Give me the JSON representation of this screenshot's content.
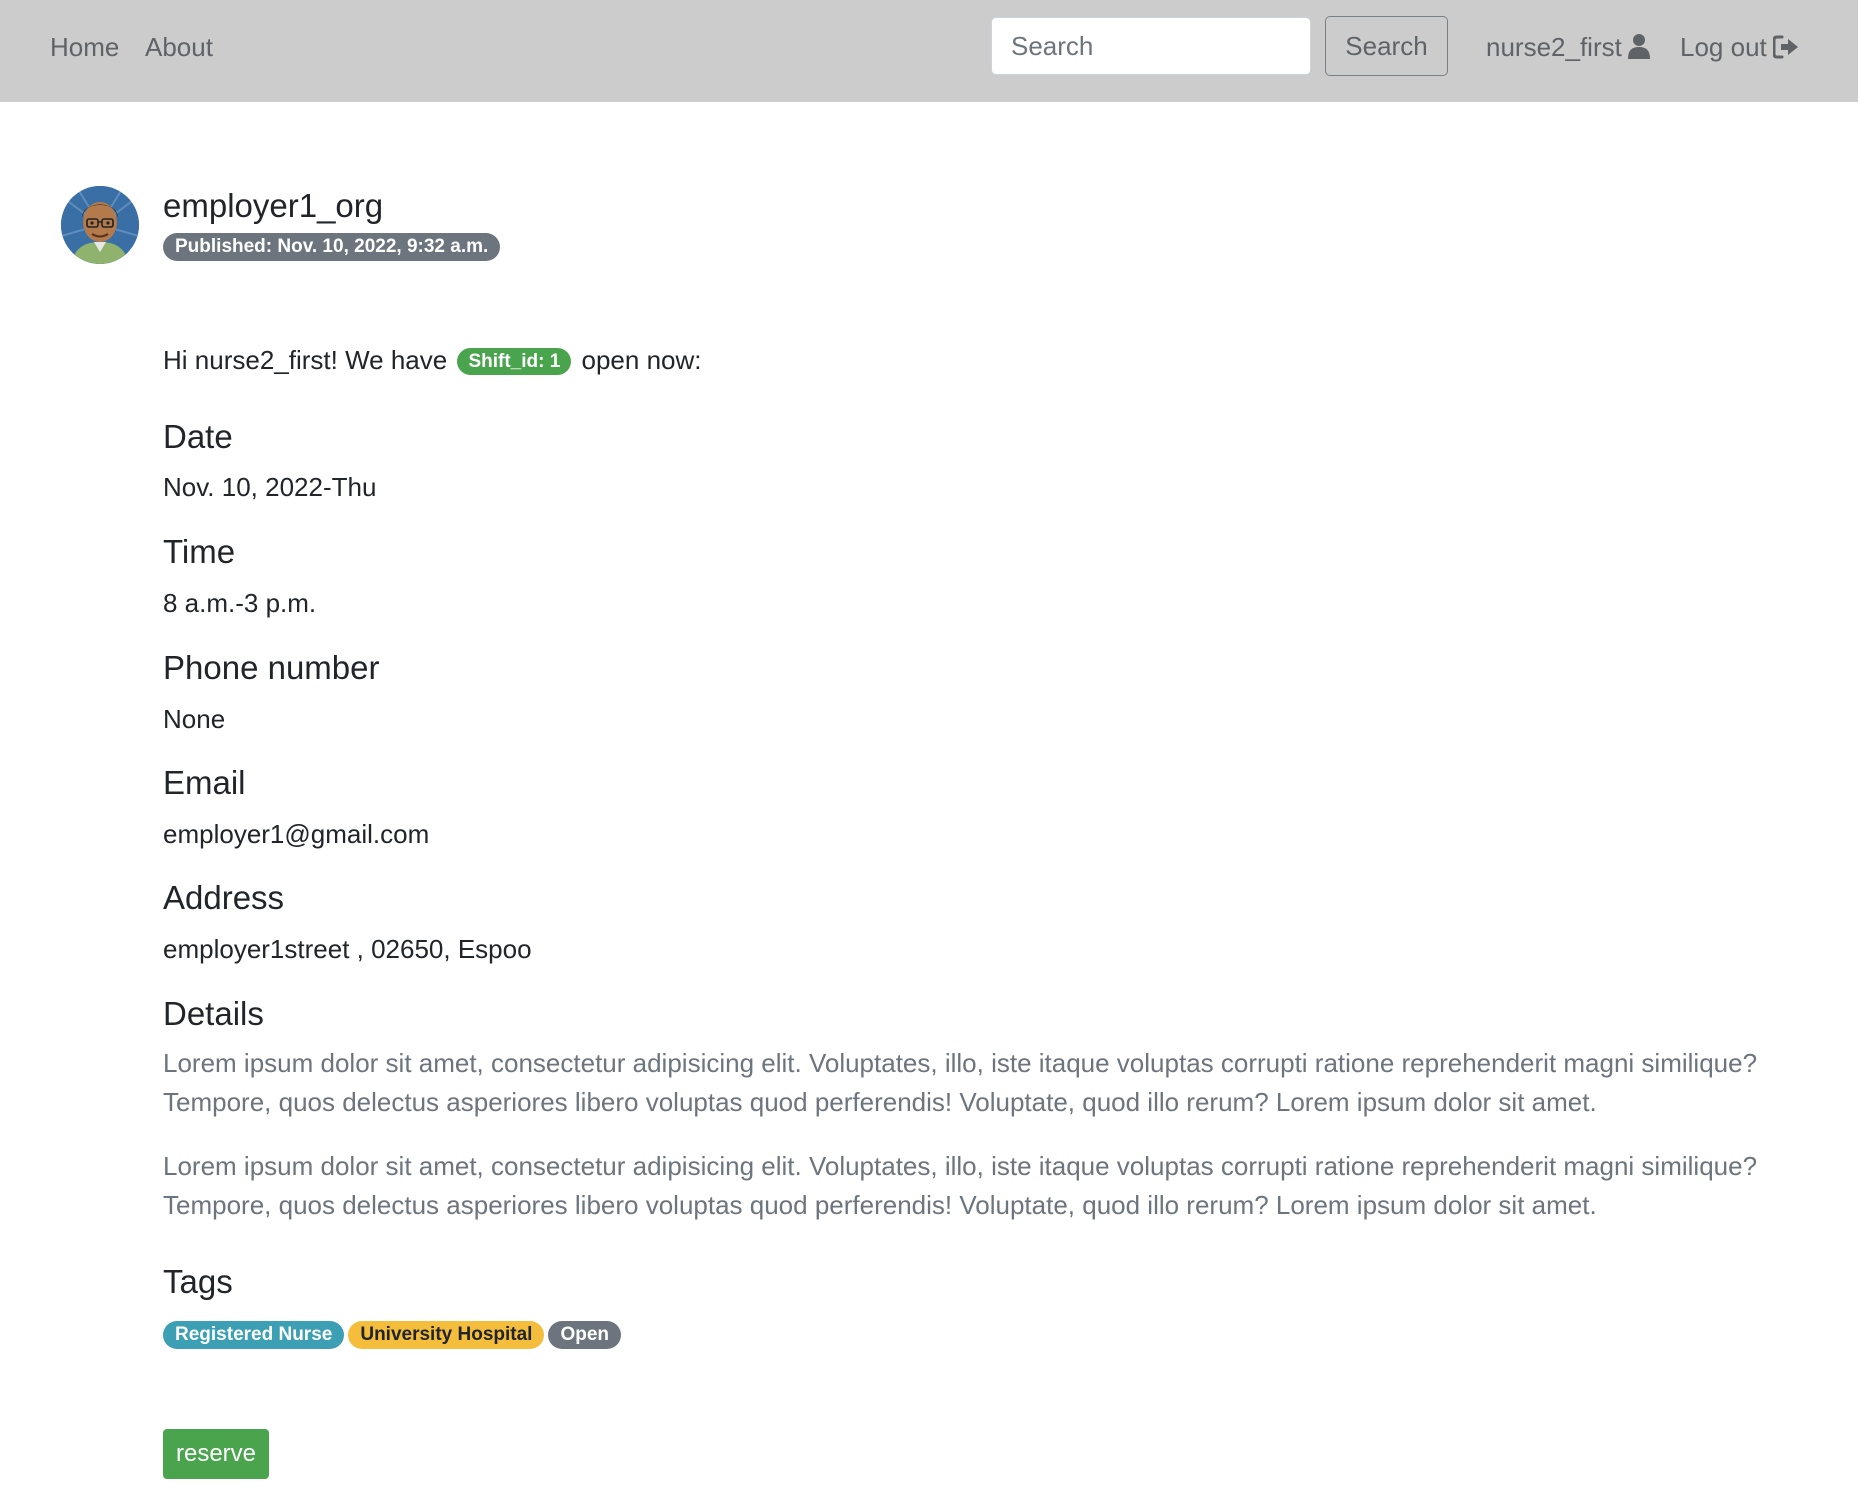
{
  "navbar": {
    "home": "Home",
    "about": "About",
    "search_placeholder": "Search",
    "search_button": "Search",
    "username": "nurse2_first",
    "logout": "Log out"
  },
  "post": {
    "author": "employer1_org",
    "published": "Published: Nov. 10, 2022, 9:32 a.m.",
    "intro_before": "Hi nurse2_first! We have",
    "shift_badge": "Shift_id: 1",
    "intro_after": "open now:",
    "sections": {
      "date": {
        "title": "Date",
        "value": "Nov. 10, 2022-Thu"
      },
      "time": {
        "title": "Time",
        "value": "8 a.m.-3 p.m."
      },
      "phone": {
        "title": "Phone number",
        "value": "None"
      },
      "email": {
        "title": "Email",
        "value": "employer1@gmail.com"
      },
      "address": {
        "title": "Address",
        "value": "employer1street , 02650, Espoo"
      }
    },
    "details_title": "Details",
    "details_paragraphs": [
      "Lorem ipsum dolor sit amet, consectetur adipisicing elit. Voluptates, illo, iste itaque voluptas corrupti ratione reprehenderit magni similique? Tempore, quos delectus asperiores libero voluptas quod perferendis! Voluptate, quod illo rerum? Lorem ipsum dolor sit amet.",
      "Lorem ipsum dolor sit amet, consectetur adipisicing elit. Voluptates, illo, iste itaque voluptas corrupti ratione reprehenderit magni similique? Tempore, quos delectus asperiores libero voluptas quod perferendis! Voluptate, quod illo rerum? Lorem ipsum dolor sit amet."
    ],
    "tags_title": "Tags",
    "tags": [
      "Registered Nurse",
      "University Hospital",
      "Open"
    ],
    "reserve_button": "reserve"
  },
  "colors": {
    "navbar_bg": "#cccccc",
    "badge_secondary": "#6c757d",
    "badge_success": "#4aa44e",
    "badge_info": "#3c9fb4",
    "badge_warning": "#f5bd3c",
    "button_success": "#4aa44e"
  },
  "icons": {
    "user": "user-icon",
    "logout": "sign-out-icon",
    "avatar": "avatar-image"
  }
}
